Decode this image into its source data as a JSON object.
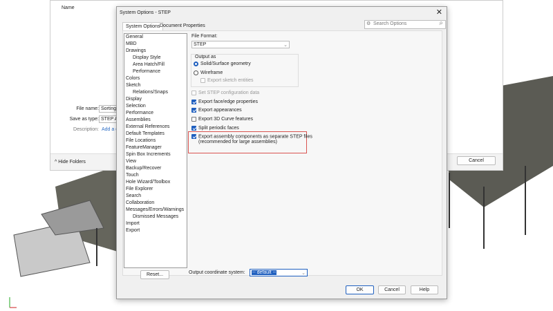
{
  "background_window": {
    "column_name": "Name",
    "file_name_label": "File name:",
    "file_name_value": "Sorting",
    "save_as_type_label": "Save as type:",
    "save_as_type_value": "STEP AP",
    "description_label": "Description:",
    "description_link": "Add a d",
    "hide_folders": "Hide Folders",
    "cancel": "Cancel"
  },
  "dialog": {
    "title": "System Options - STEP",
    "tabs": [
      "System Options",
      "Document Properties"
    ],
    "search_placeholder": "Search Options",
    "tree": [
      {
        "label": "General"
      },
      {
        "label": "MBD"
      },
      {
        "label": "Drawings"
      },
      {
        "label": "Display Style",
        "sub": true
      },
      {
        "label": "Area Hatch/Fill",
        "sub": true
      },
      {
        "label": "Performance",
        "sub": true
      },
      {
        "label": "Colors"
      },
      {
        "label": "Sketch"
      },
      {
        "label": "Relations/Snaps",
        "sub": true
      },
      {
        "label": "Display"
      },
      {
        "label": "Selection"
      },
      {
        "label": "Performance"
      },
      {
        "label": "Assemblies"
      },
      {
        "label": "External References"
      },
      {
        "label": "Default Templates"
      },
      {
        "label": "File Locations"
      },
      {
        "label": "FeatureManager"
      },
      {
        "label": "Spin Box Increments"
      },
      {
        "label": "View"
      },
      {
        "label": "Backup/Recover"
      },
      {
        "label": "Touch"
      },
      {
        "label": "Hole Wizard/Toolbox"
      },
      {
        "label": "File Explorer"
      },
      {
        "label": "Search"
      },
      {
        "label": "Collaboration"
      },
      {
        "label": "Messages/Errors/Warnings"
      },
      {
        "label": "Dismissed Messages",
        "sub": true
      },
      {
        "label": "Import"
      },
      {
        "label": "Export"
      }
    ],
    "reset": "Reset...",
    "file_format_label": "File Format:",
    "file_format_value": "STEP",
    "output_as_label": "Output as",
    "radio_solid": "Solid/Surface geometry",
    "radio_wireframe": "Wireframe",
    "export_sketch": "Export sketch entities",
    "set_config": "Set STEP configuration data",
    "opt_face_edge": "Export face/edge properties",
    "opt_appearances": "Export appearances",
    "opt_3d_curve": "Export 3D Curve features",
    "opt_split": "Split periodic faces",
    "opt_assembly_line1": "Export assembly components as separate STEP files",
    "opt_assembly_line2": "(recommended for large assemblies)",
    "coord_label": "Output coordinate system:",
    "coord_value": "-- default --",
    "ok": "OK",
    "cancel": "Cancel",
    "help": "Help",
    "highlight_color": "#d9534f"
  }
}
